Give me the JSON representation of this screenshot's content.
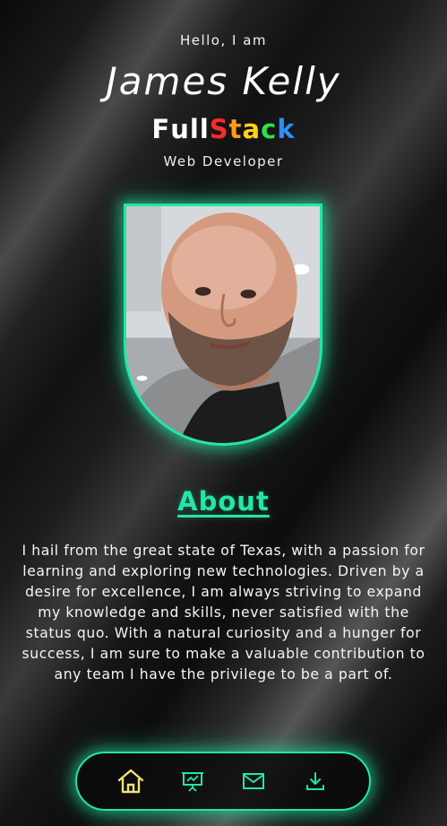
{
  "hero": {
    "greeting": "Hello, I am",
    "name": "James Kelly",
    "title_letters": [
      {
        "char": "F",
        "color": "#ffffff"
      },
      {
        "char": "u",
        "color": "#ffffff"
      },
      {
        "char": "l",
        "color": "#ffffff"
      },
      {
        "char": "l",
        "color": "#ffffff"
      },
      {
        "char": "S",
        "color": "#ff2a2a"
      },
      {
        "char": "t",
        "color": "#ff9a1a"
      },
      {
        "char": "a",
        "color": "#ffd21a"
      },
      {
        "char": "c",
        "color": "#2ee04a"
      },
      {
        "char": "k",
        "color": "#2f8cff"
      }
    ],
    "role": "Web Developer"
  },
  "about": {
    "heading": "About",
    "body": "I hail from the great state of Texas, with a passion for learning and exploring new technologies. Driven by a desire for excellence, I am always striving to expand my knowledge and skills, never satisfied with the status quo. With a natural curiosity and a hunger for success, I am sure to make a valuable contribution to any team I have the privilege to be a part of."
  },
  "nav": {
    "items": [
      {
        "icon": "home-icon",
        "active": true
      },
      {
        "icon": "presentation-icon",
        "active": false
      },
      {
        "icon": "mail-icon",
        "active": false
      },
      {
        "icon": "download-icon",
        "active": false
      }
    ]
  },
  "colors": {
    "accent": "#22e6a8",
    "active_icon": "#f5e27a"
  }
}
